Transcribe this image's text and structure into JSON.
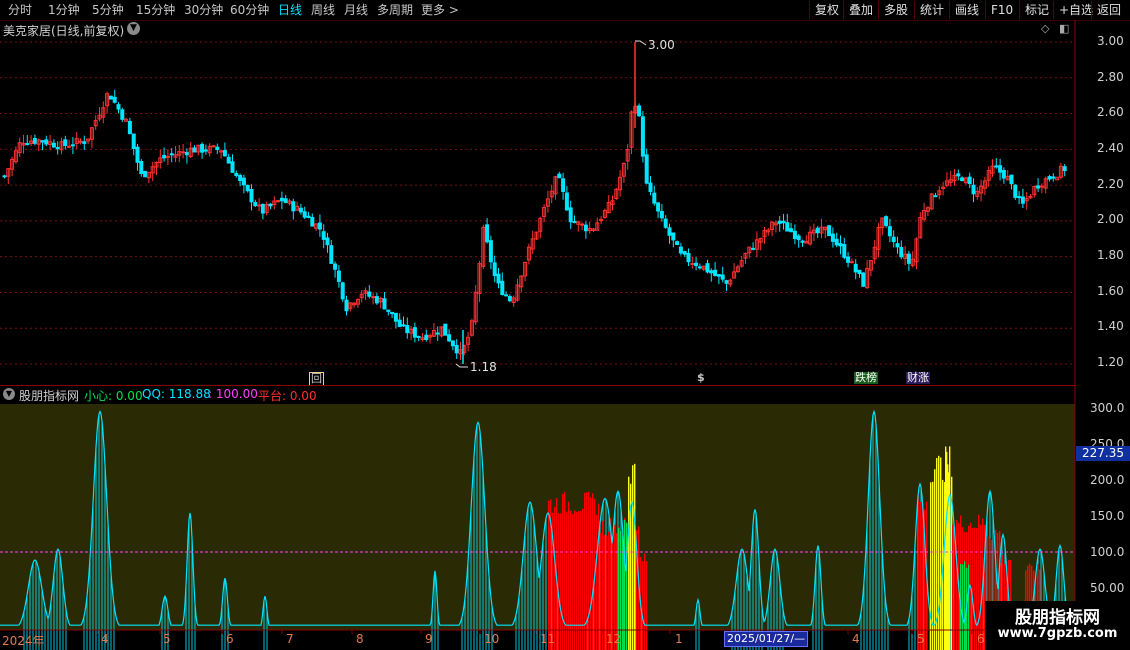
{
  "toolbar": {
    "periods": [
      "分时",
      "1分钟",
      "5分钟",
      "15分钟",
      "30分钟",
      "60分钟",
      "日线",
      "周线",
      "月线",
      "多周期",
      "更多 >"
    ],
    "active_period": "日线",
    "buttons": [
      "复权",
      "叠加",
      "多股",
      "统计",
      "画线",
      "F10",
      "标记",
      "+自选",
      "返回"
    ]
  },
  "main_chart": {
    "title": "美克家居(日线,前复权)",
    "price_labels": [
      "3.00",
      "2.80",
      "2.60",
      "2.40",
      "2.20",
      "2.00",
      "1.80",
      "1.60",
      "1.40",
      "1.20"
    ],
    "high_annotation": "3.00",
    "low_annotation": "1.18",
    "events": [
      {
        "label": "回",
        "color": "#f0d080"
      },
      {
        "label": "$",
        "color": "#ff3030"
      },
      {
        "label": "跌榜",
        "color": "#00ff60"
      },
      {
        "label": "财涨",
        "color": "#ff80ff"
      }
    ],
    "colors": {
      "up": "#ff3232",
      "down": "#00e5ff",
      "grid": "#7a1010"
    }
  },
  "indicator": {
    "name": "股朋指标网",
    "fields": [
      {
        "label": "小心: 0.00",
        "color": "#00e050"
      },
      {
        "label": "QQ: 118.88",
        "color": "#00e5ff"
      },
      {
        "label": ": 100.00",
        "color": "#ff40ff"
      },
      {
        "label": "平台: 0.00",
        "color": "#ff3030"
      }
    ],
    "y_labels": [
      "300.0",
      "250.0",
      "200.0",
      "150.0",
      "100.0",
      "50.00"
    ],
    "current_value": "227.35",
    "colors": {
      "panel_bg": "#2a2a05",
      "qq": "#00e5ff",
      "bar_red": "#ff0000",
      "bar_yellow": "#ffff10",
      "bar_green": "#00e050",
      "line100": "#ff40ff"
    }
  },
  "x_axis": {
    "labels": [
      "2024年",
      "4",
      "5",
      "6",
      "7",
      "8",
      "9",
      "10",
      "11",
      "12",
      "1",
      "4",
      "5",
      "6"
    ],
    "cursor_date": "2025/01/27/—"
  },
  "watermark": {
    "line1": "股朋指标网",
    "line2": "www.7gpzb.com"
  }
}
